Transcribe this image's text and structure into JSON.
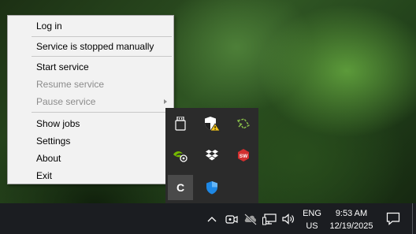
{
  "context_menu": {
    "items": [
      {
        "label": "Log in",
        "enabled": true
      },
      {
        "label": "Service is stopped manually",
        "enabled": true
      },
      {
        "label": "Start service",
        "enabled": true
      },
      {
        "label": "Resume service",
        "enabled": false
      },
      {
        "label": "Pause service",
        "enabled": false,
        "has_submenu": true
      },
      {
        "label": "Show jobs",
        "enabled": true
      },
      {
        "label": "Settings",
        "enabled": true
      },
      {
        "label": "About",
        "enabled": true
      },
      {
        "label": "Exit",
        "enabled": true
      }
    ]
  },
  "tray_overflow": {
    "icons": [
      {
        "name": "usb-drive-icon"
      },
      {
        "name": "security-warning-icon"
      },
      {
        "name": "snip-tool-icon"
      },
      {
        "name": "nvidia-icon"
      },
      {
        "name": "dropbox-icon"
      },
      {
        "name": "app-red-icon",
        "label": "SW"
      },
      {
        "name": "active-service-icon",
        "label": "C"
      },
      {
        "name": "defender-shield-icon"
      }
    ]
  },
  "taskbar": {
    "language": "ENG",
    "region": "US",
    "time": "9:53 AM",
    "date": "12/19/2025",
    "icons": [
      "chevron-up-icon",
      "meet-now-icon",
      "cloud-offline-icon",
      "network-icon",
      "volume-icon",
      "notification-icon"
    ]
  },
  "colors": {
    "menu_background": "#f2f2f2",
    "disabled_text": "#8c8c8c",
    "flyout_background": "#2b2b2b",
    "taskbar_background": "#1b1d21",
    "dropbox_blue": "#1e88e5",
    "nvidia_green": "#76b900",
    "warning_yellow": "#f5c518",
    "app_red": "#d32f2f"
  }
}
